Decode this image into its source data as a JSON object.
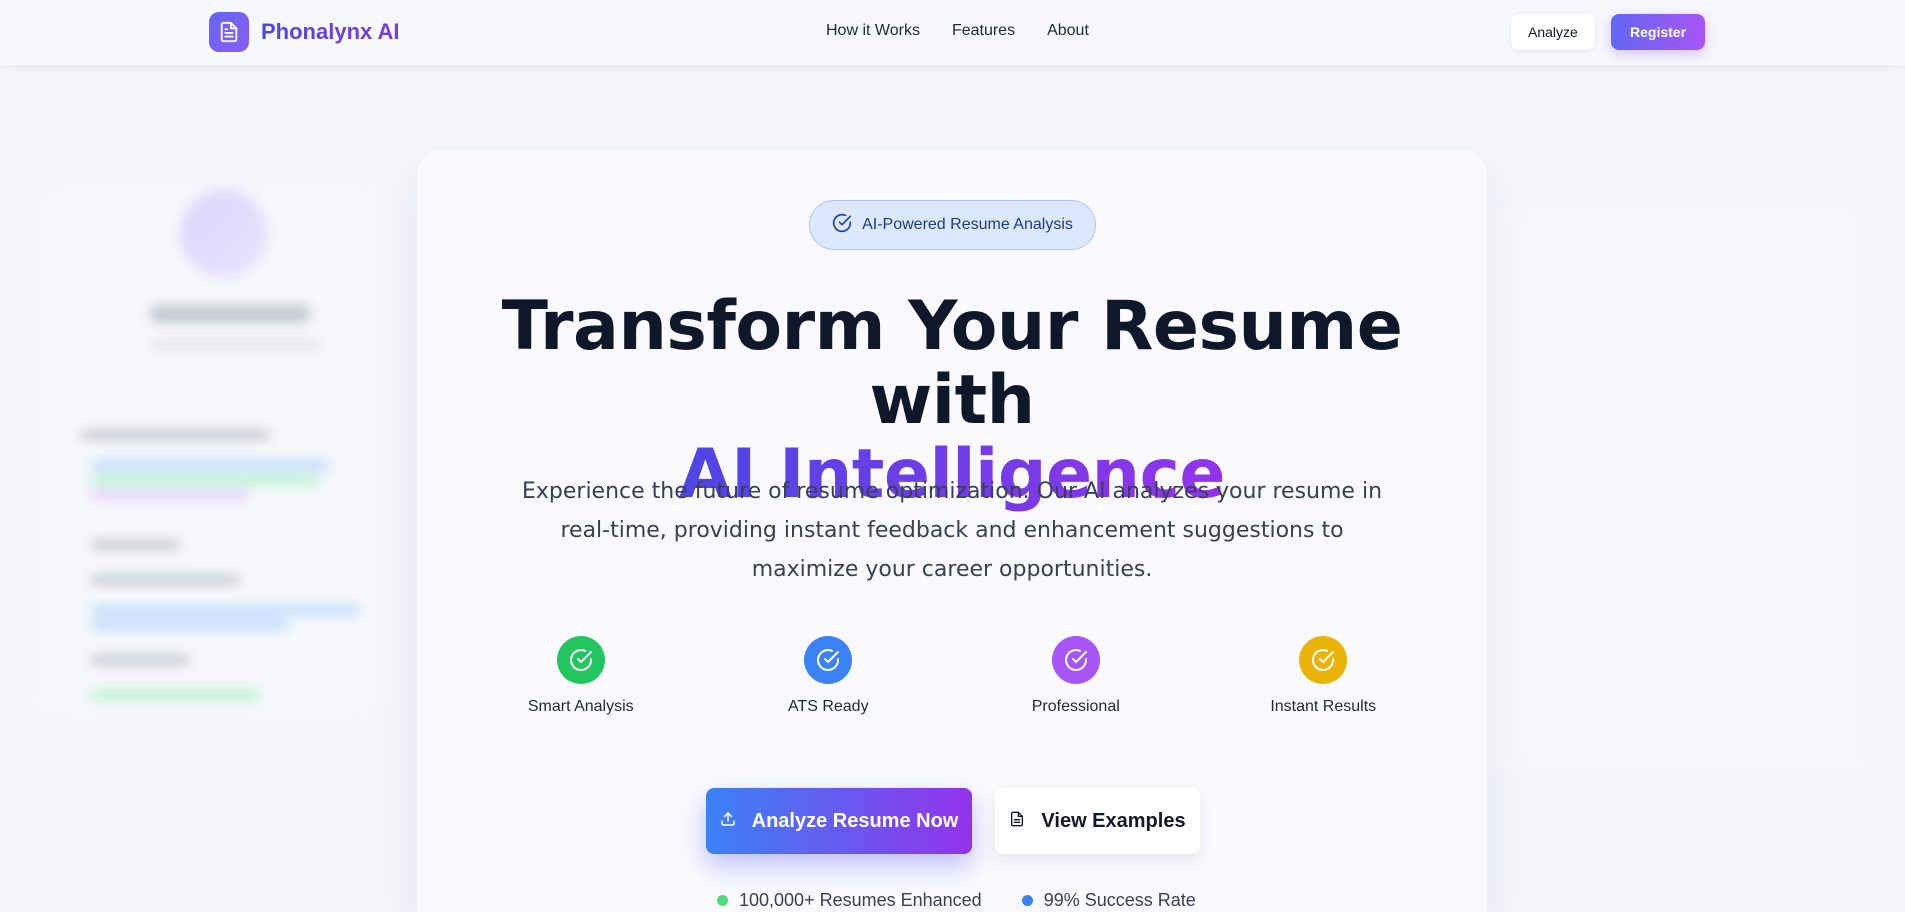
{
  "nav": {
    "brand": "Phonalynx AI",
    "links": [
      "How it Works",
      "Features",
      "About"
    ],
    "analyze_label": "Analyze",
    "register_label": "Register"
  },
  "hero": {
    "badge": "AI-Powered Resume Analysis",
    "headline_line1": "Transform Your Resume with",
    "headline_line2": "AI Intelligence",
    "subtext": "Experience the future of resume optimization. Our AI analyzes your resume in real-time, providing instant feedback and enhancement suggestions to maximize your career opportunities.",
    "features": [
      {
        "label": "Smart Analysis",
        "color": "#22c55e",
        "icon": "check-circle-icon"
      },
      {
        "label": "ATS Ready",
        "color": "#3b82f6",
        "icon": "check-circle-icon"
      },
      {
        "label": "Professional",
        "color": "#a855f7",
        "icon": "check-circle-icon"
      },
      {
        "label": "Instant Results",
        "color": "#eab308",
        "icon": "check-circle-icon"
      }
    ],
    "cta_primary": "Analyze Resume Now",
    "cta_secondary": "View Examples",
    "stats": [
      {
        "label": "100,000+ Resumes Enhanced",
        "color": "#4ade80"
      },
      {
        "label": "99% Success Rate",
        "color": "#3b82f6"
      }
    ]
  },
  "colors": {
    "accent": "#6366f1",
    "accent2": "#9333ea",
    "badge_bg": "#dbe8fd"
  }
}
